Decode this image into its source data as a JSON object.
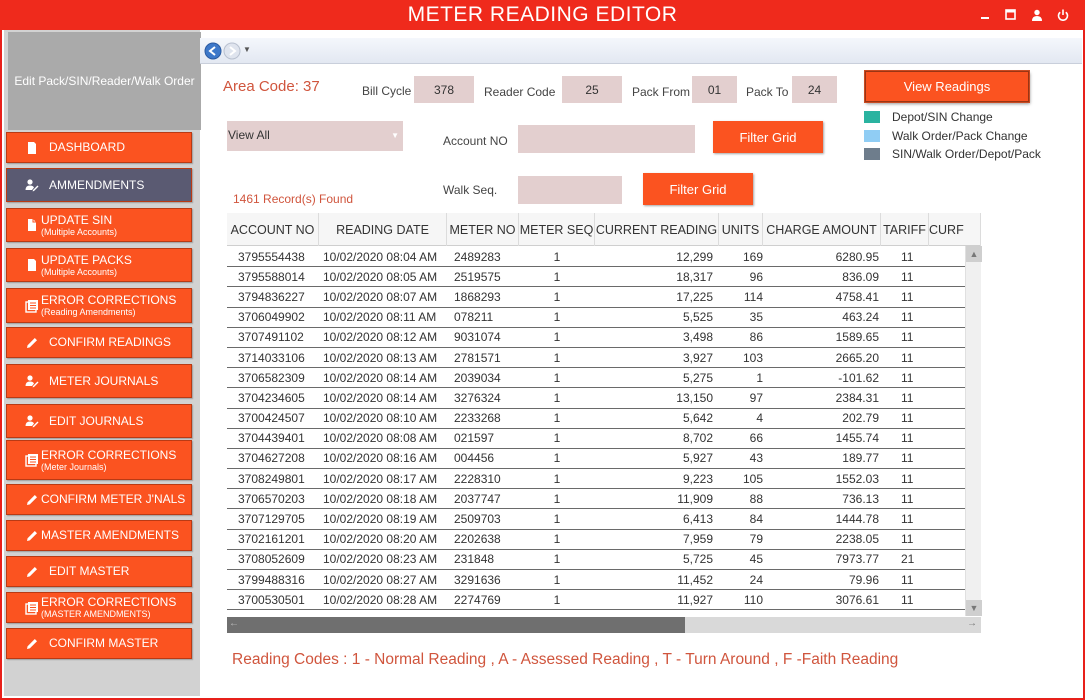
{
  "window": {
    "title": "METER READING EDITOR",
    "controls": [
      "minimize-icon",
      "maximize-icon",
      "user-icon",
      "power-icon"
    ]
  },
  "sidebar": {
    "header": "Edit Pack/SIN/Reader/Walk Order",
    "items": [
      {
        "label": "DASHBOARD",
        "sub": "",
        "icon": "document-icon",
        "active": false
      },
      {
        "label": "AMMENDMENTS",
        "sub": "",
        "icon": "user-edit-icon",
        "active": true
      },
      {
        "label": "UPDATE SIN",
        "sub": "(Multiple Accounts)",
        "icon": "page-icon",
        "active": false
      },
      {
        "label": "UPDATE PACKS",
        "sub": "(Multiple Accounts)",
        "icon": "document-icon",
        "active": false
      },
      {
        "label": "ERROR CORRECTIONS",
        "sub": "(Reading Amendments)",
        "icon": "list-icon",
        "active": false
      },
      {
        "label": "CONFIRM READINGS",
        "sub": "",
        "icon": "pencil-icon",
        "active": false
      },
      {
        "label": "METER JOURNALS",
        "sub": "",
        "icon": "user-edit-icon",
        "active": false
      },
      {
        "label": "EDIT JOURNALS",
        "sub": "",
        "icon": "user-edit-icon",
        "active": false
      },
      {
        "label": "ERROR CORRECTIONS",
        "sub": "(Meter Journals)",
        "icon": "list-icon",
        "active": false
      },
      {
        "label": "CONFIRM METER J'NALS",
        "sub": "",
        "icon": "pencil-icon",
        "active": false
      },
      {
        "label": "MASTER AMENDMENTS",
        "sub": "",
        "icon": "pencil-icon",
        "active": false
      },
      {
        "label": "EDIT MASTER",
        "sub": "",
        "icon": "pencil-icon",
        "active": false
      },
      {
        "label": "ERROR CORRECTIONS",
        "sub": "(MASTER AMENDMENTS)",
        "icon": "list-icon",
        "active": false
      },
      {
        "label": "CONFIRM MASTER",
        "sub": "",
        "icon": "pencil-icon",
        "active": false
      }
    ]
  },
  "form": {
    "area_code": "Area Code: 37",
    "bill_cycle_label": "Bill Cycle",
    "bill_cycle": "378",
    "reader_code_label": "Reader Code",
    "reader_code": "25",
    "pack_from_label": "Pack From",
    "pack_from": "01",
    "pack_to_label": "Pack To",
    "pack_to": "24",
    "view_readings": "View Readings",
    "filter_select": "View All",
    "account_no_label": "Account NO",
    "account_no": "",
    "filter_grid_1": "Filter Grid",
    "walk_seq_label": "Walk Seq.",
    "walk_seq": "",
    "filter_grid_2": "Filter Grid",
    "records_found": "1461 Record(s) Found"
  },
  "legend": [
    {
      "label": "Depot/SIN Change",
      "color": "#2ab3a0"
    },
    {
      "label": "Walk Order/Pack Change",
      "color": "#90cdf4"
    },
    {
      "label": "SIN/Walk Order/Depot/Pack",
      "color": "#6e7d8c"
    }
  ],
  "grid": {
    "columns": [
      "ACCOUNT NO",
      "READING DATE",
      "METER NO",
      "METER SEQ",
      "CURRENT READING",
      "UNITS",
      "CHARGE AMOUNT",
      "TARIFF",
      "CURF"
    ],
    "rows": [
      [
        "3795554438",
        "10/02/2020 08:04 AM",
        "2489283",
        "1",
        "12,299",
        "169",
        "6280.95",
        "11"
      ],
      [
        "3795588014",
        "10/02/2020 08:05 AM",
        "2519575",
        "1",
        "18,317",
        "96",
        "836.09",
        "11"
      ],
      [
        "3794836227",
        "10/02/2020 08:07 AM",
        "1868293",
        "1",
        "17,225",
        "114",
        "4758.41",
        "11"
      ],
      [
        "3706049902",
        "10/02/2020 08:11 AM",
        "078211",
        "1",
        "5,525",
        "35",
        "463.24",
        "11"
      ],
      [
        "3707491102",
        "10/02/2020 08:12 AM",
        "9031074",
        "1",
        "3,498",
        "86",
        "1589.65",
        "11"
      ],
      [
        "3714033106",
        "10/02/2020 08:13 AM",
        "2781571",
        "1",
        "3,927",
        "103",
        "2665.20",
        "11"
      ],
      [
        "3706582309",
        "10/02/2020 08:14 AM",
        "2039034",
        "1",
        "5,275",
        "1",
        "-101.62",
        "11"
      ],
      [
        "3704234605",
        "10/02/2020 08:14 AM",
        "3276324",
        "1",
        "13,150",
        "97",
        "2384.31",
        "11"
      ],
      [
        "3700424507",
        "10/02/2020 08:10 AM",
        "2233268",
        "1",
        "5,642",
        "4",
        "202.79",
        "11"
      ],
      [
        "3704439401",
        "10/02/2020 08:08 AM",
        "021597",
        "1",
        "8,702",
        "66",
        "1455.74",
        "11"
      ],
      [
        "3704627208",
        "10/02/2020 08:16 AM",
        "004456",
        "1",
        "5,927",
        "43",
        "189.77",
        "11"
      ],
      [
        "3708249801",
        "10/02/2020 08:17 AM",
        "2228310",
        "1",
        "9,223",
        "105",
        "1552.03",
        "11"
      ],
      [
        "3706570203",
        "10/02/2020 08:18 AM",
        "2037747",
        "1",
        "11,909",
        "88",
        "736.13",
        "11"
      ],
      [
        "3707129705",
        "10/02/2020 08:19 AM",
        "2509703",
        "1",
        "6,413",
        "84",
        "1444.78",
        "11"
      ],
      [
        "3702161201",
        "10/02/2020 08:20 AM",
        "2202638",
        "1",
        "7,959",
        "79",
        "2238.05",
        "11"
      ],
      [
        "3708052609",
        "10/02/2020 08:23 AM",
        "231848",
        "1",
        "5,725",
        "45",
        "7973.77",
        "21"
      ],
      [
        "3799488316",
        "10/02/2020 08:27 AM",
        "3291636",
        "1",
        "11,452",
        "24",
        "79.96",
        "11"
      ],
      [
        "3700530501",
        "10/02/2020 08:28 AM",
        "2274769",
        "1",
        "11,927",
        "110",
        "3076.61",
        "11"
      ]
    ]
  },
  "footer": {
    "reading_codes": "Reading Codes : 1 - Normal Reading , A - Assessed Reading , T - Turn Around , F -Faith Reading"
  }
}
